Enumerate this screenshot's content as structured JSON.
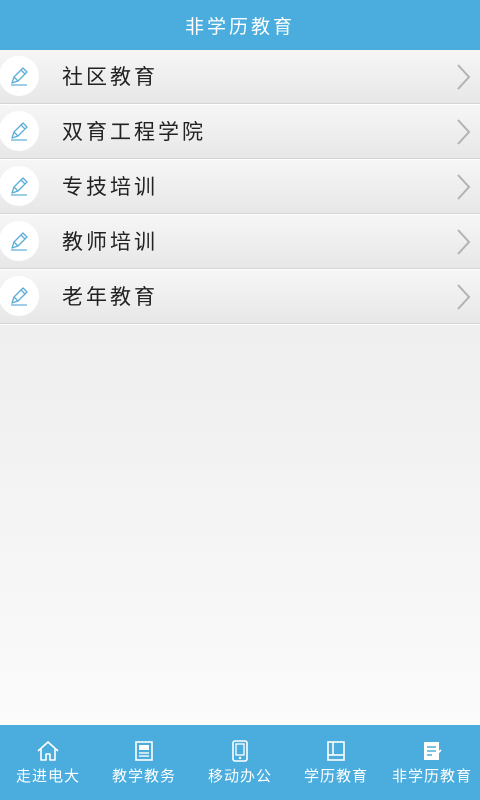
{
  "header": {
    "title": "非学历教育"
  },
  "menu": {
    "items": [
      {
        "label": "社区教育",
        "icon": "pencil-icon"
      },
      {
        "label": "双育工程学院",
        "icon": "pencil-icon"
      },
      {
        "label": "专技培训",
        "icon": "pencil-icon"
      },
      {
        "label": "教师培训",
        "icon": "pencil-icon"
      },
      {
        "label": "老年教育",
        "icon": "pencil-icon"
      }
    ]
  },
  "tabbar": {
    "items": [
      {
        "label": "走进电大",
        "icon": "home-icon"
      },
      {
        "label": "教学教务",
        "icon": "newspaper-icon"
      },
      {
        "label": "移动办公",
        "icon": "tablet-icon"
      },
      {
        "label": "学历教育",
        "icon": "book-icon"
      },
      {
        "label": "非学历教育",
        "icon": "notepad-icon",
        "active": true
      }
    ]
  },
  "colors": {
    "accent": "#4badde",
    "list_icon": "#5aaed6",
    "chevron": "#b2b2b2"
  }
}
